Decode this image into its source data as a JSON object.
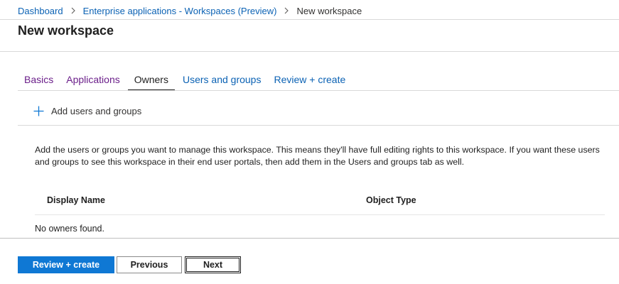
{
  "breadcrumb": {
    "items": [
      "Dashboard",
      "Enterprise applications - Workspaces (Preview)"
    ],
    "current": "New workspace"
  },
  "page": {
    "title": "New workspace"
  },
  "tabs": [
    {
      "label": "Basics",
      "state": "visited"
    },
    {
      "label": "Applications",
      "state": "visited"
    },
    {
      "label": "Owners",
      "state": "active"
    },
    {
      "label": "Users and groups",
      "state": "link"
    },
    {
      "label": "Review + create",
      "state": "link"
    }
  ],
  "command": {
    "add_label": "Add users and groups",
    "icon": "plus-icon"
  },
  "description": "Add the users or groups you want to manage this workspace. This means they'll have full editing rights to this workspace. If you want these users and groups to see this workspace in their end user portals, then add them in the Users and groups tab as well.",
  "table": {
    "columns": [
      "Display Name",
      "Object Type"
    ],
    "empty_message": "No owners found."
  },
  "footer": {
    "review_create_label": "Review + create",
    "previous_label": "Previous",
    "next_label": "Next"
  },
  "colors": {
    "link": "#0b62b4",
    "visited": "#6b1f8a",
    "primary_button": "#0f78d4"
  }
}
